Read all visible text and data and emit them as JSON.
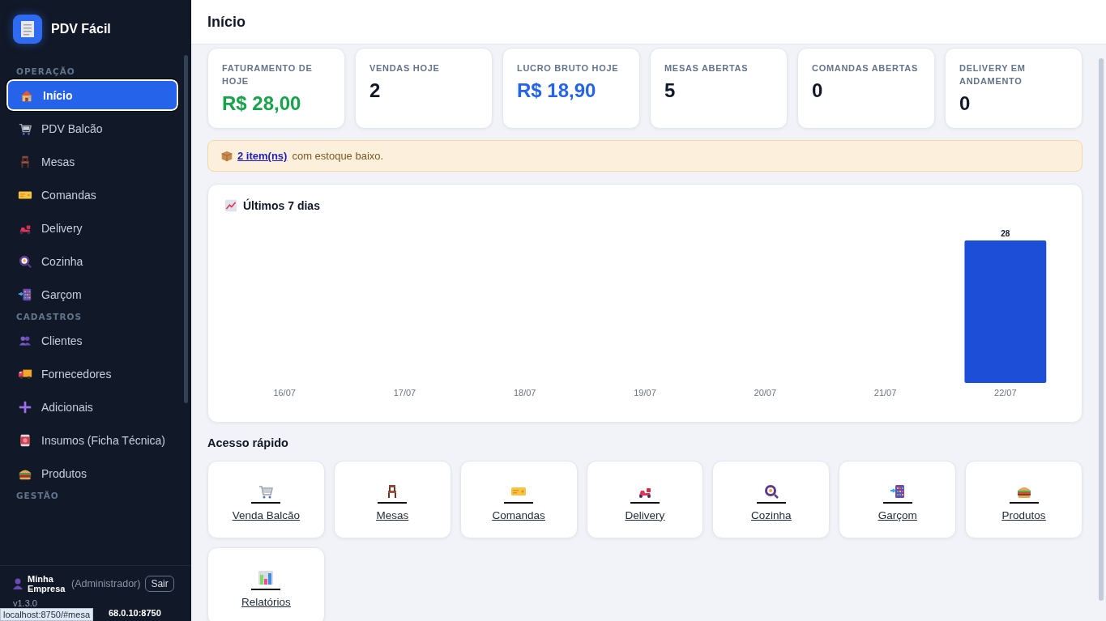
{
  "sidebar": {
    "brand": "PDV Fácil",
    "sections": [
      {
        "title": "OPERAÇÃO",
        "items": [
          {
            "label": "Início",
            "selected": true
          },
          {
            "label": "PDV Balcão",
            "selected": false
          },
          {
            "label": "Mesas",
            "selected": false
          },
          {
            "label": "Comandas",
            "selected": false
          },
          {
            "label": "Delivery",
            "selected": false
          },
          {
            "label": "Cozinha",
            "selected": false
          },
          {
            "label": "Garçom",
            "selected": false
          }
        ]
      },
      {
        "title": "CADASTROS",
        "items": [
          {
            "label": "Clientes",
            "selected": false
          },
          {
            "label": "Fornecedores",
            "selected": false
          },
          {
            "label": "Adicionais",
            "selected": false
          },
          {
            "label": "Insumos (Ficha Técnica)",
            "selected": false
          },
          {
            "label": "Produtos",
            "selected": false
          }
        ]
      },
      {
        "title": "GESTÃO"
      }
    ],
    "user": {
      "name": "Minha Empresa",
      "role": "(Administrador)",
      "logout": "Sair"
    },
    "version": "v1.3.0",
    "address": "68.0.10:8750"
  },
  "status_url": "localhost:8750/#mesa",
  "page_title": "Início",
  "stats": [
    {
      "label": "FATURAMENTO DE HOJE",
      "value": "R$ 28,00",
      "color": "#16a34a"
    },
    {
      "label": "VENDAS HOJE",
      "value": "2",
      "color": "#111827"
    },
    {
      "label": "LUCRO BRUTO HOJE",
      "value": "R$ 18,90",
      "color": "#2563eb"
    },
    {
      "label": "MESAS ABERTAS",
      "value": "5",
      "color": "#111827"
    },
    {
      "label": "COMANDAS ABERTAS",
      "value": "0",
      "color": "#111827"
    },
    {
      "label": "DELIVERY EM ANDAMENTO",
      "value": "0",
      "color": "#111827"
    }
  ],
  "alert": {
    "link": "2 item(ns)",
    "text": "com estoque baixo."
  },
  "chart_card": {
    "title": "Últimos 7 dias",
    "chart_data": {
      "type": "bar",
      "categories": [
        "16/07",
        "17/07",
        "18/07",
        "19/07",
        "20/07",
        "21/07",
        "22/07"
      ],
      "series": [
        {
          "color": "#1d4ed8",
          "values": [
            null,
            null,
            null,
            null,
            null,
            null,
            28
          ]
        }
      ],
      "data_labels": true
    }
  },
  "quick_access": {
    "title": "Acesso rápido",
    "items": [
      "Venda Balcão",
      "Mesas",
      "Comandas",
      "Delivery",
      "Cozinha",
      "Garçom",
      "Produtos",
      "Relatórios"
    ]
  }
}
